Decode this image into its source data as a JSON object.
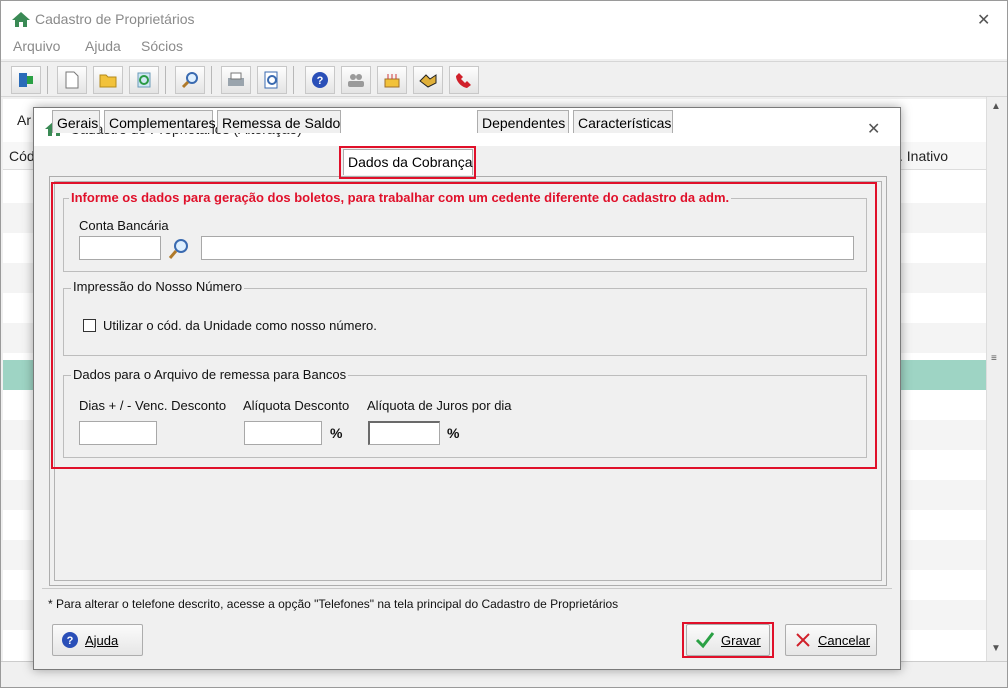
{
  "main_window": {
    "title": "Cadastro de Proprietários",
    "close_glyph": "✕",
    "menu": [
      "Arquivo",
      "Ajuda",
      "Sócios"
    ],
    "bg_label_ar": "Ar",
    "bg_col_code": "Cód",
    "bg_col_inativo": ". Inativo"
  },
  "dialog": {
    "title": "Cadastro de Proprietários (Alteração)",
    "close_glyph": "✕",
    "tabs": [
      "Gerais",
      "Complementares",
      "Remessa de Saldo",
      "Dados da Cobrança",
      "Dependentes",
      "Características"
    ],
    "active_tab": "Dados da Cobrança",
    "cobranca": {
      "info": "Informe os dados para geração dos boletos, para trabalhar com um cedente diferente do cadastro da adm.",
      "conta_label": "Conta Bancária",
      "conta_code": "",
      "conta_desc": "",
      "impressao_group": "Impressão do Nosso Número",
      "checkbox_label": "Utilizar o cód. da Unidade como nosso número.",
      "checkbox_checked": false,
      "remessa_group": "Dados para o Arquivo de remessa para Bancos",
      "dias_label": "Dias + / - Venc. Desconto",
      "dias_value": "",
      "aliq_desc_label": "Alíquota Desconto",
      "aliq_desc_value": "",
      "aliq_juros_label": "Alíquota de Juros por dia",
      "aliq_juros_value": "",
      "percent": "%"
    },
    "note": "* Para alterar o telefone descrito, acesse a opção \"Telefones\" na tela principal do Cadastro de Proprietários",
    "buttons": {
      "help": "Ajuda",
      "save": "Gravar",
      "cancel": "Cancelar"
    }
  },
  "colors": {
    "highlight_red": "#e0102a",
    "selected_row": "#9ed4c4",
    "info_red": "#e0102a"
  },
  "toolbar_icons": [
    "exit-icon",
    "new-icon",
    "open-icon",
    "refresh-icon",
    "search-icon",
    "print-icon",
    "preview-icon",
    "help-icon",
    "users-icon",
    "cake-icon",
    "handshake-icon",
    "phone-icon"
  ]
}
